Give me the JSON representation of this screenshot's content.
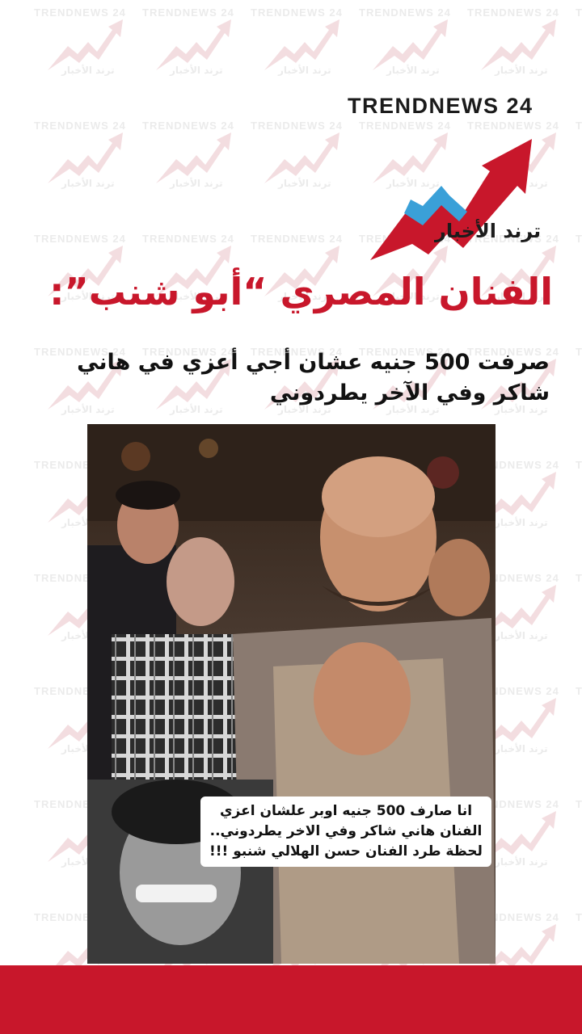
{
  "watermark": {
    "brand": "TRENDNEWS 24",
    "brand_ar": "ترند الأخبار"
  },
  "logo": {
    "brand": "TRENDNEWS 24",
    "brand_ar": "ترند الأخبار",
    "colors": {
      "red": "#c8172b",
      "blue": "#3aa0d8",
      "dark": "#1b1b1b"
    }
  },
  "headline": "الفنان المصري “أبو شنب”:",
  "subheadline": "صرفت 500 جنيه عشان أجي أعزي في هاني شاكر وفي الآخر يطردوني",
  "photo": {
    "caption": "انا صارف 500 جنيه اوبر علشان اعزي الفنان هاني شاكر وفي الاخر يطردوني.. لحظة طرد الفنان حسن الهلالي شنبو !!!"
  },
  "theme": {
    "accent": "#c8172b",
    "background": "#ffffff"
  }
}
